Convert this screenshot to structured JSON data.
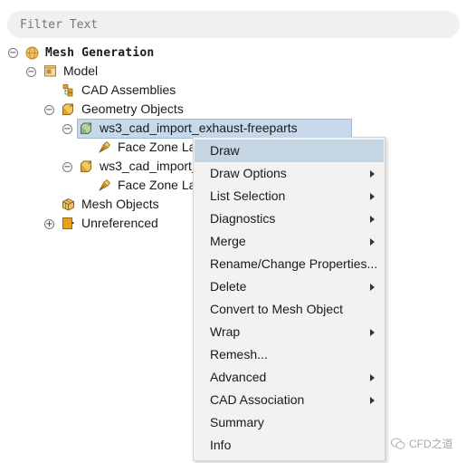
{
  "filter": {
    "placeholder": "Filter Text"
  },
  "tree": {
    "root": "Mesh Generation",
    "model": "Model",
    "cad_assemblies": "CAD Assemblies",
    "geometry_objects": "Geometry Objects",
    "geom_item_1": "ws3_cad_import_exhaust-freeparts",
    "geom_item_1_child": "Face Zone La",
    "geom_item_2": "ws3_cad_import_",
    "geom_item_2_child": "Face Zone La",
    "mesh_objects": "Mesh Objects",
    "unreferenced": "Unreferenced",
    "toggle_minus": "−",
    "toggle_plus": "+"
  },
  "context_menu": {
    "items": [
      {
        "label": "Draw",
        "submenu": false
      },
      {
        "label": "Draw Options",
        "submenu": true
      },
      {
        "label": "List Selection",
        "submenu": true
      },
      {
        "label": "Diagnostics",
        "submenu": true
      },
      {
        "label": "Merge",
        "submenu": true
      },
      {
        "label": "Rename/Change Properties...",
        "submenu": false
      },
      {
        "label": "Delete",
        "submenu": true
      },
      {
        "label": "Convert to Mesh Object",
        "submenu": false
      },
      {
        "label": "Wrap",
        "submenu": true
      },
      {
        "label": "Remesh...",
        "submenu": false
      },
      {
        "label": "Advanced",
        "submenu": true
      },
      {
        "label": "CAD Association",
        "submenu": true
      },
      {
        "label": "Summary",
        "submenu": false
      },
      {
        "label": "Info",
        "submenu": false
      }
    ]
  },
  "watermark": {
    "text": "CFD之道"
  },
  "colors": {
    "selection": "#c6d9ea",
    "menu_bg": "#f2f2f2",
    "menu_highlight": "#c6d5e2",
    "icon_orange": "#e7a21b",
    "icon_green": "#8fb47a"
  }
}
